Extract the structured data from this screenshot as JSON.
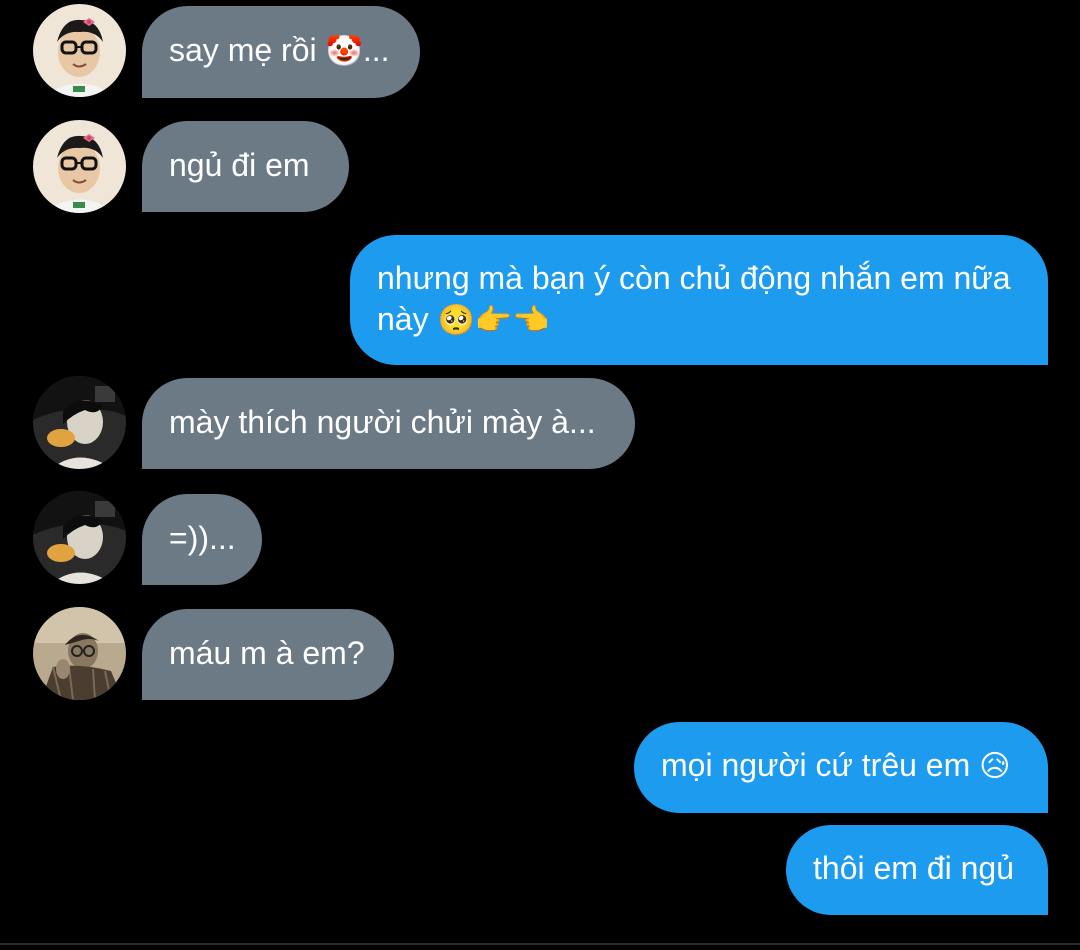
{
  "conversation": {
    "messages": [
      {
        "sender": "other",
        "avatar": "avatar-boy-glasses-icon",
        "text": "say mẹ rồi",
        "emoji": "🤡",
        "suffix": "..."
      },
      {
        "sender": "other",
        "avatar": "avatar-boy-glasses-icon",
        "text": "ngủ đi em"
      },
      {
        "sender": "me",
        "text": "nhưng mà bạn ý còn chủ động nhắn em nữa này",
        "emoji": "🥺👉👈"
      },
      {
        "sender": "other",
        "avatar": "avatar-dark-portrait-icon",
        "text": "mày thích người chửi mày à..."
      },
      {
        "sender": "other",
        "avatar": "avatar-dark-portrait-icon",
        "text": "=))..."
      },
      {
        "sender": "other",
        "avatar": "avatar-sepia-portrait-icon",
        "text": "máu m à em?"
      },
      {
        "sender": "me",
        "text": "mọi người cứ trêu em",
        "emoji": "😥"
      },
      {
        "sender": "me",
        "text": "thôi em đi ngủ"
      }
    ]
  },
  "colors": {
    "background": "#000000",
    "incoming_bubble": "#6c7a86",
    "outgoing_bubble": "#1d9bef",
    "text": "#ffffff"
  }
}
